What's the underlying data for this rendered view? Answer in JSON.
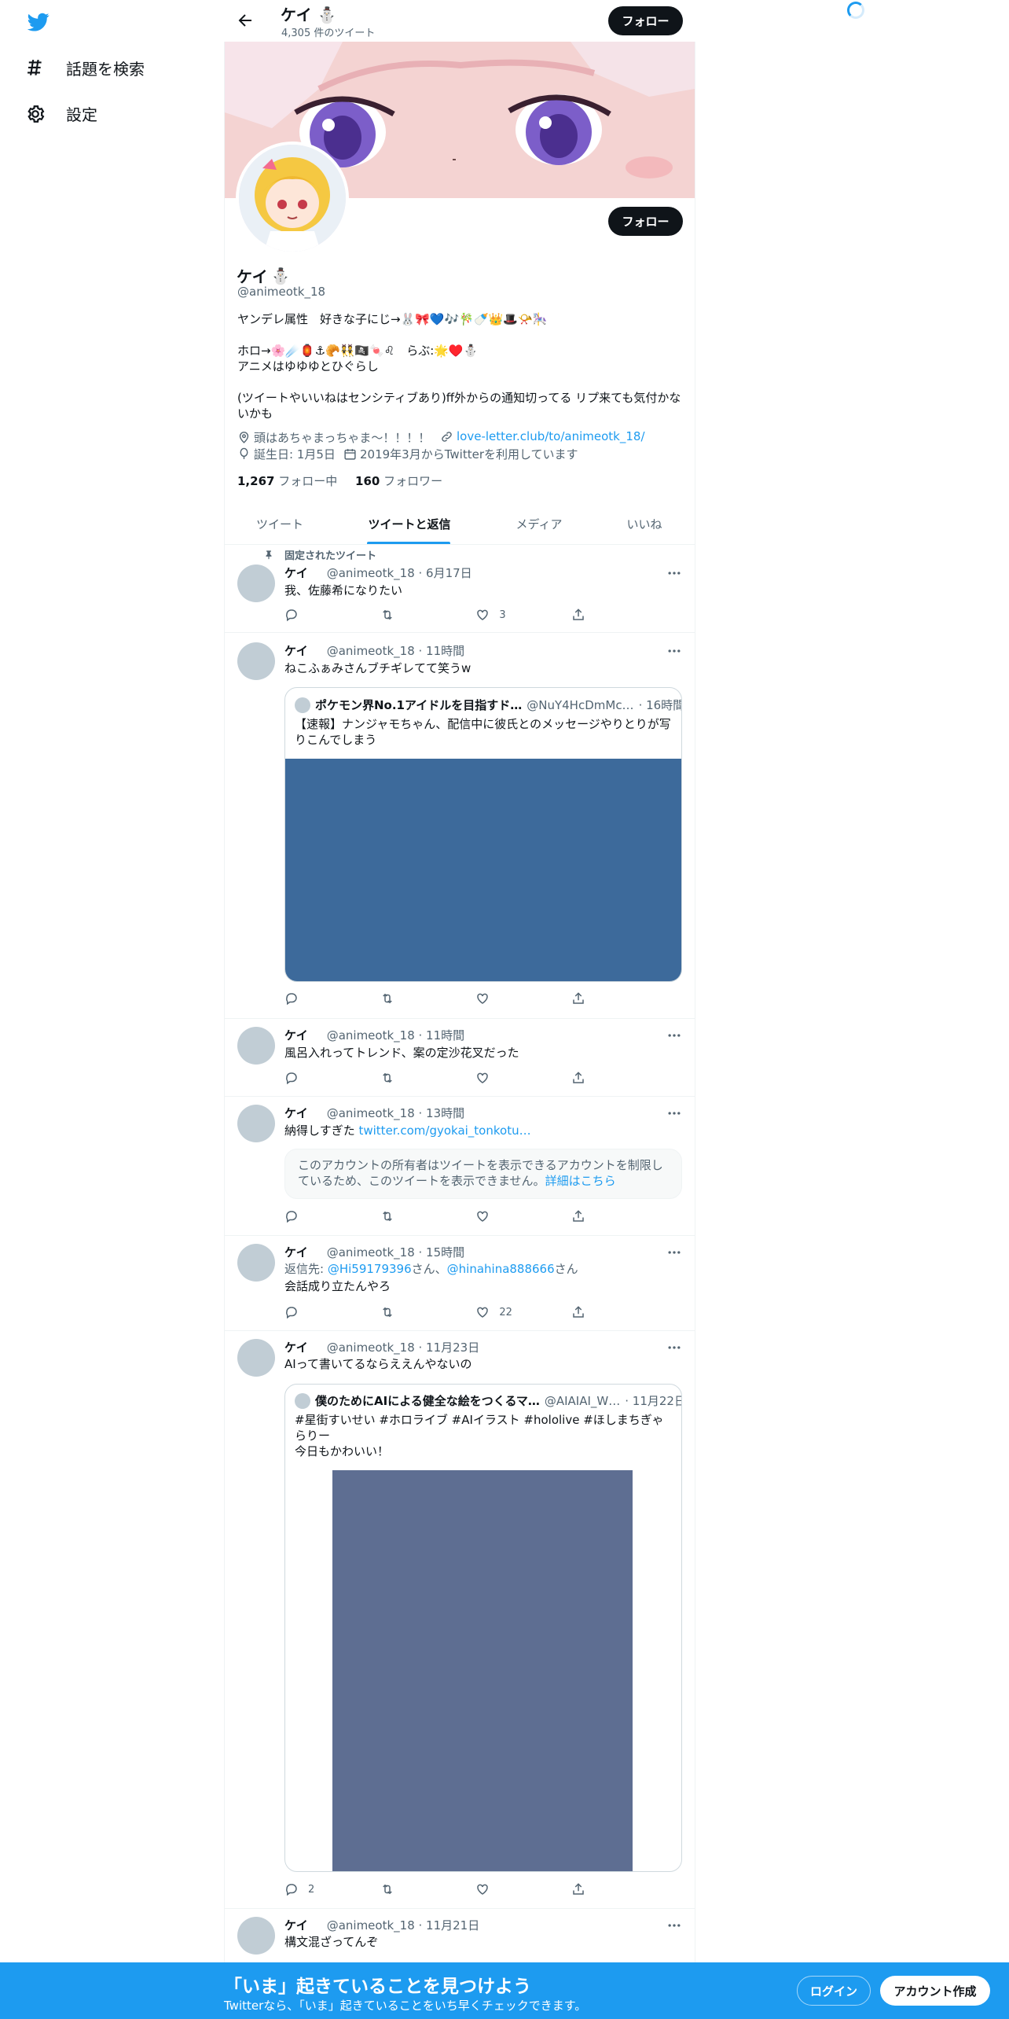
{
  "nav": {
    "explore_label": "話題を検索",
    "settings_label": "設定"
  },
  "header": {
    "name": "ケイ",
    "tweet_count": "4,305 件のツイート",
    "follow_label": "フォロー"
  },
  "profile": {
    "name": "ケイ",
    "handle": "@animeotk_18",
    "follow_label": "フォロー",
    "bio_line1": "ヤンデレ属性　好きな子にじ→🐰🎀💙🎶🎋🍼👑🎩📯🎠",
    "bio_line2": "ホロ→🌸☄️🏮⚓🥐👯🏴‍☠️🍬♌　らぶ:🌟♥️⛄",
    "bio_line3": "アニメはゆゆゆとひぐらし",
    "bio_line4": "(ツイートやいいねはセンシティブあり)ff外からの通知切ってる リプ来ても気付かないかも",
    "location": "頭はあちゃまっちゃま～！！！！",
    "url": "love-letter.club/to/animeotk_18/",
    "birthday": "誕生日: 1月5日",
    "joined": "2019年3月からTwitterを利用しています",
    "following_count": "1,267",
    "following_label": "フォロー中",
    "followers_count": "160",
    "followers_label": "フォロワー"
  },
  "tabs": [
    {
      "label": "ツイート"
    },
    {
      "label": "ツイートと返信"
    },
    {
      "label": "メディア"
    },
    {
      "label": "いいね"
    }
  ],
  "pinned_label": "固定されたツイート",
  "tweets": [
    {
      "name": "ケイ",
      "meta": "@animeotk_18 · 6月17日",
      "text": "我、佐藤希になりたい",
      "like_count": "3"
    },
    {
      "name": "ケイ",
      "meta": "@animeotk_18 · 11時間",
      "text": "ねこふぁみさんブチギレてて笑うw",
      "quote": {
        "name": "ポケモン界No.1アイドルを目指すド…",
        "handle": "@NuY4HcDmMc…",
        "time": "· 16時間",
        "text": "【速報】ナンジャモちゃん、配信中に彼氏とのメッセージやりとりが写りこんでしまう",
        "image_color": "#3d6a9b"
      }
    },
    {
      "name": "ケイ",
      "meta": "@animeotk_18 · 11時間",
      "text": "風呂入れってトレンド、案の定沙花叉だった"
    },
    {
      "name": "ケイ",
      "meta": "@animeotk_18 · 13時間",
      "text": "納得しすぎた",
      "link": "twitter.com/gyokai_tonkotu…",
      "notice": "このアカウントの所有者はツイートを表示できるアカウントを制限しているため、このツイートを表示できません。",
      "notice_link": "詳細はこちら"
    },
    {
      "name": "ケイ",
      "meta": "@animeotk_18 · 15時間",
      "reply_prefix": "返信先: ",
      "reply_user1": "@Hi59179396",
      "reply_san1": "さん、",
      "reply_user2": "@hinahina888666",
      "reply_san2": "さん",
      "text": "会話成り立たんやろ",
      "like_count": "22"
    },
    {
      "name": "ケイ",
      "meta": "@animeotk_18 · 11月23日",
      "text": "AIって書いてるならええんやないの",
      "reply_count": "2",
      "quote": {
        "name": "僕のためにAIによる健全な絵をつくるマ…",
        "handle": "@AIAIAI_W…",
        "time": "· 11月22日",
        "text": "#星街すいせい #ホロライブ #AIイラスト #hololive #ほしまちぎゃらりー",
        "text2": "今日もかわいい！",
        "image_color": "#5e6e92"
      }
    },
    {
      "name": "ケイ",
      "meta": "@animeotk_18 · 11月21日",
      "text": "構文混ざってんぞ"
    }
  ],
  "bottom": {
    "title": "「いま」起きていることを見つけよう",
    "subtitle": "Twitterなら、「いま」起きていることをいち早くチェックできます。",
    "login_label": "ログイン",
    "signup_label": "アカウント作成"
  },
  "colors": {
    "accent": "#1d9bf0",
    "text": "#0f1419",
    "muted": "#536471"
  }
}
